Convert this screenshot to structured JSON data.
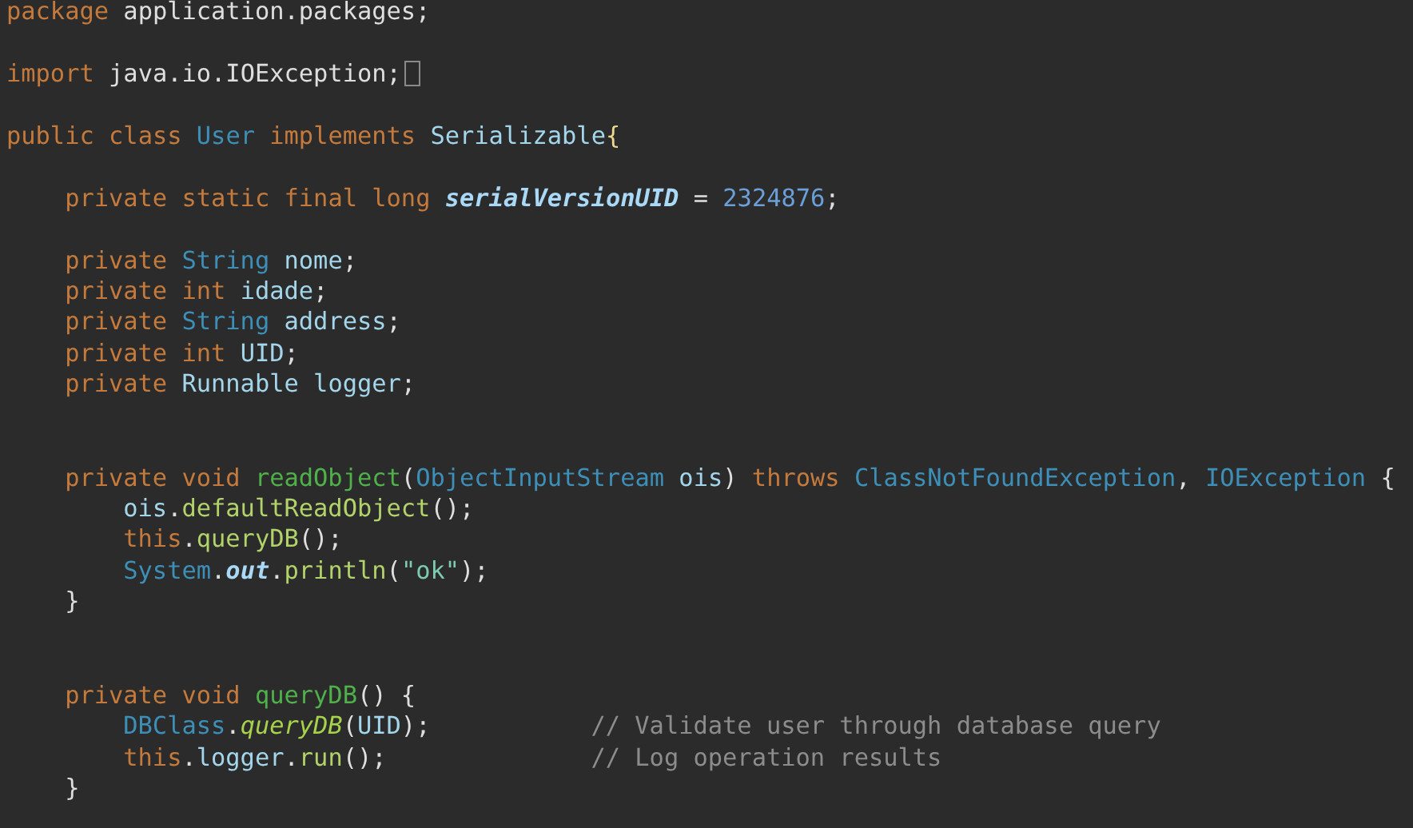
{
  "editor": {
    "lines": [
      {
        "tokens": [
          {
            "text": "package",
            "kind": "keyword"
          },
          {
            "text": "application.packages;",
            "kind": "plain",
            "gap": true
          }
        ]
      },
      {
        "blank": true
      },
      {
        "tokens": [
          {
            "text": "import",
            "kind": "keyword"
          },
          {
            "text": "java.io.IOException;",
            "kind": "plain",
            "gap": true
          },
          {
            "kind": "fold"
          }
        ]
      },
      {
        "blank": true
      },
      {
        "tokens": [
          {
            "text": "public",
            "kind": "keyword"
          },
          {
            "text": "class",
            "kind": "keyword",
            "gap": true
          },
          {
            "text": "User",
            "kind": "type",
            "gap": true
          },
          {
            "text": "implements",
            "kind": "keyword",
            "gap": true
          },
          {
            "text": "Serializable",
            "kind": "identifier",
            "gap": true
          },
          {
            "text": "{",
            "kind": "brace"
          }
        ],
        "children": [
          {
            "blank": true
          },
          {
            "tokens": [
              {
                "text": "private",
                "kind": "keyword"
              },
              {
                "text": "static",
                "kind": "keyword",
                "gap": true
              },
              {
                "text": "final",
                "kind": "keyword",
                "gap": true
              },
              {
                "text": "long",
                "kind": "keyword",
                "gap": true
              },
              {
                "text": "serialVersionUID",
                "kind": "field",
                "gap": true
              },
              {
                "text": "=",
                "kind": "plain",
                "gap": true
              },
              {
                "text": "2324876",
                "kind": "number",
                "gap": true
              },
              {
                "text": ";",
                "kind": "plain"
              }
            ]
          },
          {
            "blank": true
          },
          {
            "tokens": [
              {
                "text": "private",
                "kind": "keyword"
              },
              {
                "text": "String",
                "kind": "type",
                "gap": true
              },
              {
                "text": "nome",
                "kind": "identifier",
                "gap": true
              },
              {
                "text": ";",
                "kind": "plain"
              }
            ]
          },
          {
            "tokens": [
              {
                "text": "private",
                "kind": "keyword"
              },
              {
                "text": "int",
                "kind": "keyword",
                "gap": true
              },
              {
                "text": "idade",
                "kind": "identifier",
                "gap": true
              },
              {
                "text": ";",
                "kind": "plain"
              }
            ]
          },
          {
            "tokens": [
              {
                "text": "private",
                "kind": "keyword"
              },
              {
                "text": "String",
                "kind": "type",
                "gap": true
              },
              {
                "text": "address",
                "kind": "identifier",
                "gap": true
              },
              {
                "text": ";",
                "kind": "plain"
              }
            ]
          },
          {
            "tokens": [
              {
                "text": "private",
                "kind": "keyword"
              },
              {
                "text": "int",
                "kind": "keyword",
                "gap": true
              },
              {
                "text": "UID",
                "kind": "identifier",
                "gap": true
              },
              {
                "text": ";",
                "kind": "plain"
              }
            ]
          },
          {
            "tokens": [
              {
                "text": "private",
                "kind": "keyword"
              },
              {
                "text": "Runnable",
                "kind": "identifier",
                "gap": true
              },
              {
                "text": "logger",
                "kind": "identifier",
                "gap": true
              },
              {
                "text": ";",
                "kind": "plain"
              }
            ]
          },
          {
            "blank": true
          },
          {
            "blank": true
          },
          {
            "tokens": [
              {
                "text": "private",
                "kind": "keyword"
              },
              {
                "text": "void",
                "kind": "keyword",
                "gap": true
              },
              {
                "text": "readObject",
                "kind": "method",
                "gap": true
              },
              {
                "text": "(",
                "kind": "plain"
              },
              {
                "text": "ObjectInputStream",
                "kind": "type"
              },
              {
                "text": "ois",
                "kind": "identifier",
                "gap": true
              },
              {
                "text": ")",
                "kind": "plain"
              },
              {
                "text": "throws",
                "kind": "keyword",
                "gap": true
              },
              {
                "text": "ClassNotFoundException",
                "kind": "type",
                "gap": true
              },
              {
                "text": ",",
                "kind": "plain"
              },
              {
                "text": "IOException",
                "kind": "type",
                "gap": true
              },
              {
                "text": "{",
                "kind": "plain",
                "gap": true
              }
            ],
            "children": [
              {
                "tokens": [
                  {
                    "text": "ois",
                    "kind": "identifier"
                  },
                  {
                    "text": ".",
                    "kind": "plain"
                  },
                  {
                    "text": "defaultReadObject",
                    "kind": "call"
                  },
                  {
                    "text": "();",
                    "kind": "plain"
                  }
                ]
              },
              {
                "tokens": [
                  {
                    "text": "this",
                    "kind": "keyword"
                  },
                  {
                    "text": ".",
                    "kind": "plain"
                  },
                  {
                    "text": "queryDB",
                    "kind": "call"
                  },
                  {
                    "text": "();",
                    "kind": "plain"
                  }
                ]
              },
              {
                "tokens": [
                  {
                    "text": "System",
                    "kind": "type"
                  },
                  {
                    "text": ".",
                    "kind": "plain"
                  },
                  {
                    "text": "out",
                    "kind": "field"
                  },
                  {
                    "text": ".",
                    "kind": "plain"
                  },
                  {
                    "text": "println",
                    "kind": "call"
                  },
                  {
                    "text": "(",
                    "kind": "plain"
                  },
                  {
                    "text": "\"ok\"",
                    "kind": "string"
                  },
                  {
                    "text": ");",
                    "kind": "plain"
                  }
                ]
              }
            ]
          },
          {
            "tokens": [
              {
                "text": "}",
                "kind": "plain"
              }
            ]
          },
          {
            "blank": true
          },
          {
            "blank": true
          },
          {
            "tokens": [
              {
                "text": "private",
                "kind": "keyword"
              },
              {
                "text": "void",
                "kind": "keyword",
                "gap": true
              },
              {
                "text": "queryDB",
                "kind": "method",
                "gap": true
              },
              {
                "text": "() {",
                "kind": "plain"
              }
            ],
            "children": [
              {
                "tokens": [
                  {
                    "text": "DBClass",
                    "kind": "type"
                  },
                  {
                    "text": ".",
                    "kind": "plain"
                  },
                  {
                    "text": "queryDB",
                    "kind": "static-call"
                  },
                  {
                    "text": "(",
                    "kind": "plain"
                  },
                  {
                    "text": "UID",
                    "kind": "identifier"
                  },
                  {
                    "text": ");",
                    "kind": "plain"
                  }
                ],
                "comment": "// Validate user through database query"
              },
              {
                "tokens": [
                  {
                    "text": "this",
                    "kind": "keyword"
                  },
                  {
                    "text": ".",
                    "kind": "plain"
                  },
                  {
                    "text": "logger",
                    "kind": "identifier"
                  },
                  {
                    "text": ".",
                    "kind": "plain"
                  },
                  {
                    "text": "run",
                    "kind": "call"
                  },
                  {
                    "text": "();",
                    "kind": "plain"
                  }
                ],
                "comment": "// Log operation results"
              }
            ]
          },
          {
            "tokens": [
              {
                "text": "}",
                "kind": "plain"
              }
            ]
          }
        ]
      }
    ]
  }
}
